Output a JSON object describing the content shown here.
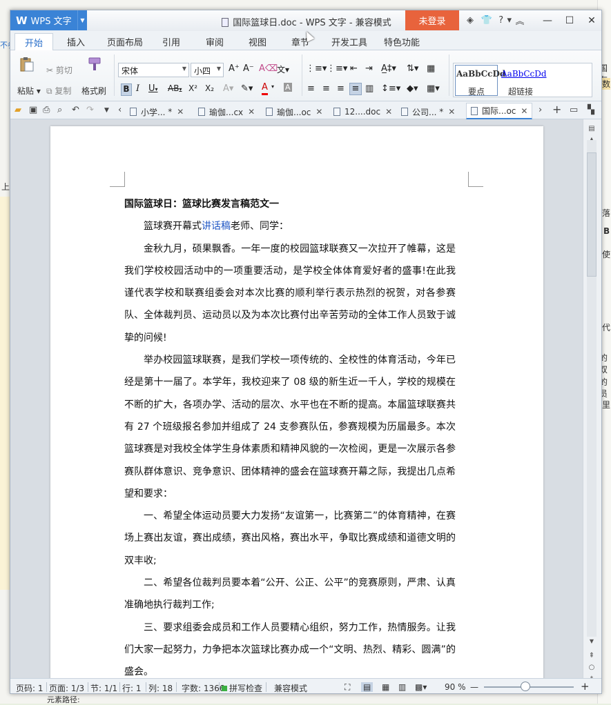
{
  "background": {
    "right_texts": [
      "国有",
      "落",
      "B",
      "使",
      "代",
      "的双",
      "的员",
      "里",
      "数"
    ],
    "left_texts": [
      "不参",
      "上"
    ],
    "bottom_text": "元素路径:"
  },
  "titlebar": {
    "app_label": "WPS 文字",
    "app_logo": "W",
    "doc_title": "国际篮球日.doc - WPS 文字 - 兼容模式",
    "login": "未登录",
    "icons": [
      "shield-icon",
      "shirt-icon",
      "help-icon",
      "collapse-icon"
    ],
    "help_label": "?",
    "win_min": "—",
    "win_max": "☐",
    "win_close": "✕"
  },
  "ribbon_tabs": [
    "开始",
    "插入",
    "页面布局",
    "引用",
    "审阅",
    "视图",
    "章节",
    "开发工具",
    "特色功能"
  ],
  "ribbon": {
    "paste": "粘贴",
    "cut": "剪切",
    "copy": "复制",
    "format_painter": "格式刷",
    "font_name": "宋体",
    "font_size": "小四",
    "bold": "B",
    "italic": "I",
    "underline": "U",
    "strike": "AB",
    "superscript": "X²",
    "subscript": "X₂",
    "styles": [
      {
        "preview": "AaBbCcDd",
        "label": "要点"
      },
      {
        "preview": "AaBbCcDd",
        "label": "超链接"
      }
    ]
  },
  "doc_tabs": [
    {
      "label": "小学...",
      "modified": true,
      "active": false
    },
    {
      "label": "瑜伽...cx",
      "modified": false,
      "active": false
    },
    {
      "label": "瑜伽...oc",
      "modified": false,
      "active": false
    },
    {
      "label": "12....doc",
      "modified": false,
      "active": false
    },
    {
      "label": "公司...",
      "modified": true,
      "active": false
    },
    {
      "label": "国际...oc",
      "modified": false,
      "active": true
    }
  ],
  "document": {
    "heading": "国际篮球日：篮球比赛发言稿范文一",
    "greeting_pre": "篮球赛开幕式",
    "greeting_link": "讲话稿",
    "greeting_post": "老师、同学：",
    "paragraphs": [
      "金秋九月，硕果飘香。一年一度的校园篮球联赛又一次拉开了帷幕，这是我们学校校园活动中的一项重要活动，是学校全体体育爱好者的盛事!在此我谨代表学校和联赛组委会对本次比赛的顺利举行表示热烈的祝贺，对各参赛队、全体裁判员、运动员以及为本次比赛付出辛苦劳动的全体工作人员致于诚挚的问候!",
      "举办校园篮球联赛，是我们学校一项传统的、全校性的体育活动，今年已经是第十一届了。本学年，我校迎来了 08 级的新生近一千人，学校的规模在不断的扩大，各项办学、活动的层次、水平也在不断的提高。本届篮球联赛共有 27 个班级报名参加并组成了 24 支参赛队伍，参赛规模为历届最多。本次篮球赛是对我校全体学生身体素质和精神风貌的一次检阅，更是一次展示各参赛队群体意识、竞争意识、团体精神的盛会在篮球赛开幕之际，我提出几点希望和要求：",
      "一、希望全体运动员要大力发扬“友谊第一，比赛第二”的体育精神，在赛场上赛出友谊，赛出成绩，赛出风格，赛出水平，争取比赛成绩和道德文明的双丰收;",
      "二、希望各位裁判员要本着“公开、公正、公平”的竞赛原则，严肃、认真准确地执行裁判工作;",
      "三、要求组委会成员和工作人员要精心组织，努力工作，热情服务。让我们大家一起努力，力争把本次篮球比赛办成一个“文明、热烈、精彩、圆满”的盛会。"
    ]
  },
  "statusbar": {
    "page_no": "页码: 1",
    "pages": "页面: 1/3",
    "section": "节: 1/1",
    "row": "行: 1",
    "col": "列: 18",
    "word_count": "字数: 1366",
    "spell_check": "拼写检查",
    "compat": "兼容模式",
    "zoom": "90 %",
    "zoom_minus": "—",
    "zoom_plus": "+"
  },
  "colors": {
    "app_blue": "#3a83d6",
    "login_orange": "#e8633c",
    "link_blue": "#1f56c4"
  }
}
